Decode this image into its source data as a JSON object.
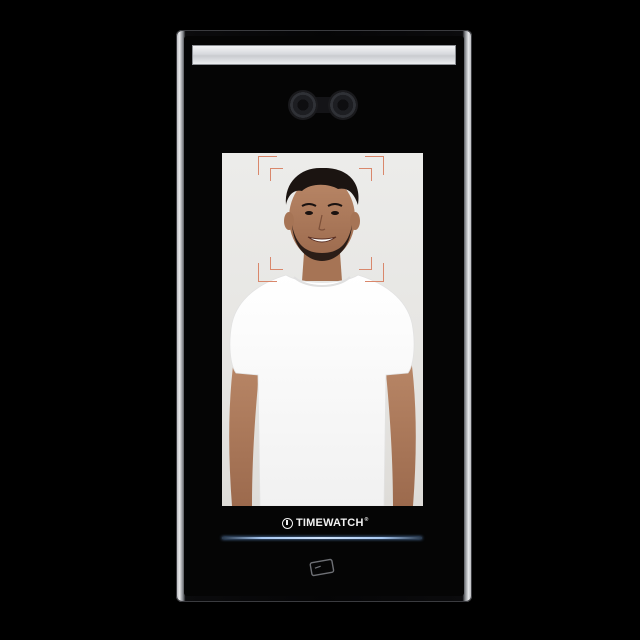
{
  "device": {
    "brand_logo_text": "TIMEWATCH",
    "brand_trademark": "®"
  },
  "icons": {
    "camera": "dual-camera-icon",
    "face_frame": "face-detection-frame-icon",
    "card_reader": "card-reader-icon"
  },
  "colors": {
    "face_frame": "#d9876b",
    "status_line": "#a9c9f2"
  }
}
